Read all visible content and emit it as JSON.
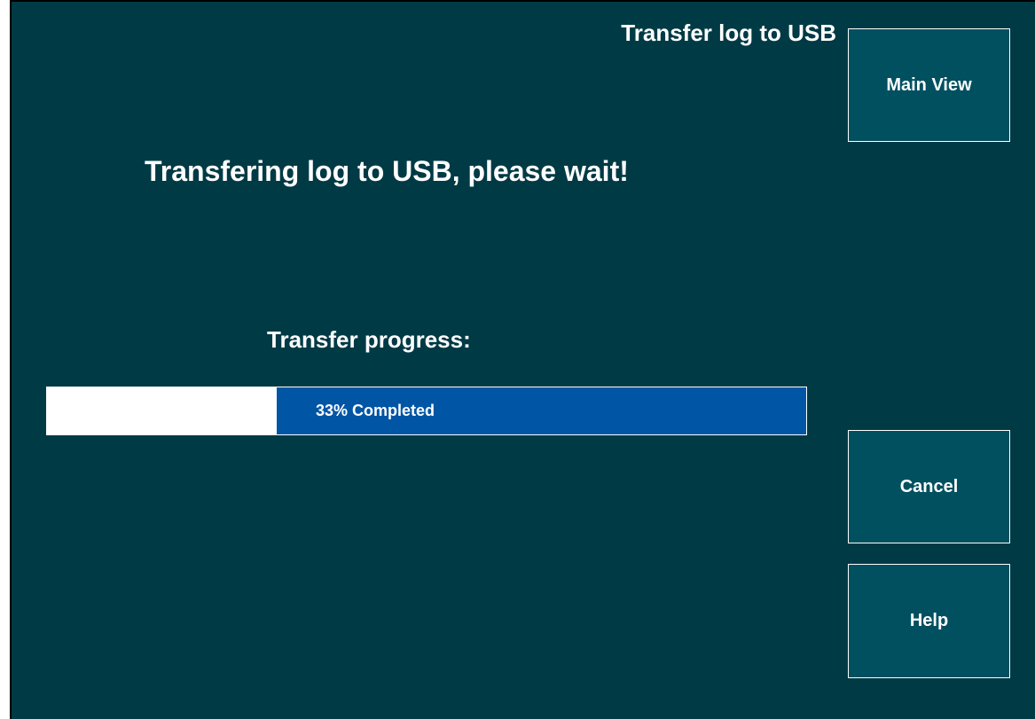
{
  "header": {
    "title": "Transfer log to USB"
  },
  "main": {
    "status_message": "Transfering log to USB, please wait!",
    "progress_label": "Transfer progress:",
    "progress": {
      "percent": 33,
      "text": "33% Completed"
    }
  },
  "buttons": {
    "main_view": "Main View",
    "cancel": "Cancel",
    "help": "Help"
  },
  "colors": {
    "background": "#003a45",
    "button_fill": "#005060",
    "progress_bar": "#0055a5",
    "text": "#ffffff"
  }
}
